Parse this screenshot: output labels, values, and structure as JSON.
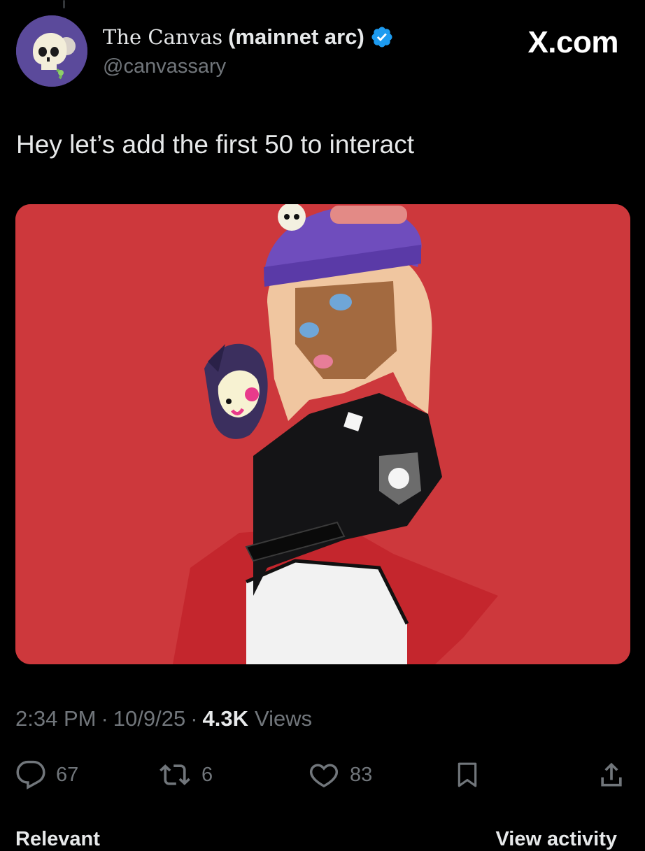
{
  "post": {
    "author": {
      "display_name": "The Canvas",
      "display_name_suffix": "(mainnet arc)",
      "handle": "@canvassary",
      "verified": true
    },
    "brand_label": "X.com",
    "text": "Hey let’s add the first 50 to interact",
    "meta": {
      "time": "2:34 PM",
      "separator": "·",
      "date": "10/9/25",
      "views_count": "4.3K",
      "views_label": "Views"
    },
    "actions": {
      "replies": "67",
      "reposts": "6",
      "likes": "83"
    }
  },
  "bottom_bar": {
    "left_label": "Relevant",
    "right_label": "View activity"
  },
  "colors": {
    "background": "#000000",
    "primary_text": "#e7e9ea",
    "secondary_text": "#71767b",
    "verified_blue": "#1d9bf0",
    "media_background": "#cd383c"
  },
  "icons": {
    "verified": "verified-badge-icon",
    "reply": "speech-bubble-icon",
    "repost": "repost-arrows-icon",
    "like": "heart-icon",
    "bookmark": "bookmark-icon",
    "share": "share-upload-icon"
  }
}
